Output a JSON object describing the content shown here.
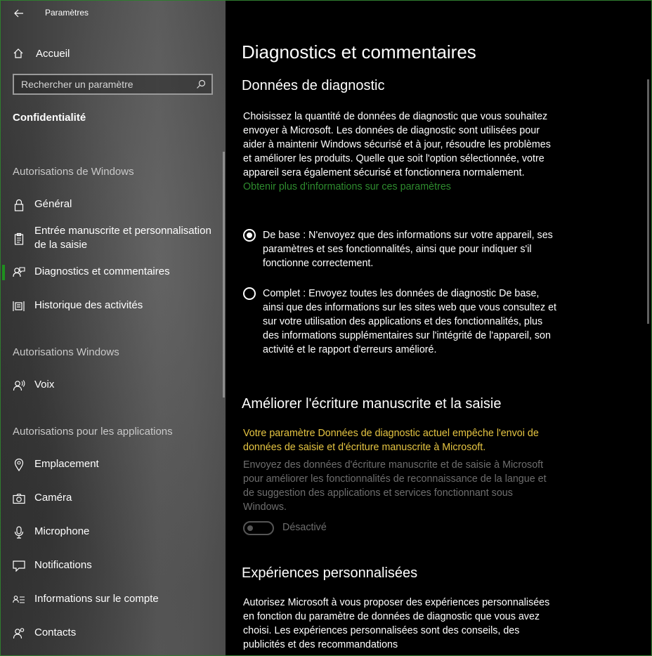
{
  "window": {
    "title": "Paramètres"
  },
  "sidebar": {
    "home_label": "Accueil",
    "search_placeholder": "Rechercher un paramètre",
    "section_title": "Confidentialité",
    "groups": [
      {
        "title": "Autorisations de Windows",
        "items": [
          {
            "label": "Général",
            "icon": "lock-icon"
          },
          {
            "label": "Entrée manuscrite et personnalisation de la saisie",
            "icon": "clipboard-icon"
          },
          {
            "label": "Diagnostics et commentaires",
            "icon": "feedback-icon",
            "active": true
          },
          {
            "label": "Historique des activités",
            "icon": "timeline-icon"
          }
        ]
      },
      {
        "title": "Autorisations Windows",
        "items": [
          {
            "label": "Voix",
            "icon": "voice-icon"
          }
        ]
      },
      {
        "title": "Autorisations pour les applications",
        "items": [
          {
            "label": "Emplacement",
            "icon": "location-icon"
          },
          {
            "label": "Caméra",
            "icon": "camera-icon"
          },
          {
            "label": "Microphone",
            "icon": "microphone-icon"
          },
          {
            "label": "Notifications",
            "icon": "notification-icon"
          },
          {
            "label": "Informations sur le compte",
            "icon": "account-info-icon"
          },
          {
            "label": "Contacts",
            "icon": "contacts-icon"
          }
        ]
      }
    ]
  },
  "main": {
    "page_title": "Diagnostics et commentaires",
    "diag": {
      "heading": "Données de diagnostic",
      "description": "Choisissez la quantité de données de diagnostic que vous souhaitez envoyer à Microsoft. Les données de diagnostic sont utilisées pour aider à maintenir Windows sécurisé et à jour, résoudre les problèmes et améliorer les produits. Quelle que soit l'option sélectionnée, votre appareil sera également sécurisé et fonctionnera normalement.",
      "link": "Obtenir plus d'informations sur ces paramètres",
      "options": [
        {
          "text": "De base : N'envoyez que des informations sur votre appareil, ses paramètres et ses fonctionnalités, ainsi que pour indiquer s'il fonctionne correctement.",
          "selected": true
        },
        {
          "text": "Complet : Envoyez toutes les données de diagnostic De base, ainsi que des informations sur les sites web que vous consultez et sur votre utilisation des applications et des fonctionnalités, plus des informations supplémentaires sur l'intégrité de l'appareil, son activité et le rapport d'erreurs amélioré.",
          "selected": false
        }
      ]
    },
    "inking": {
      "heading": "Améliorer l'écriture manuscrite et la saisie",
      "warning": "Votre paramètre Données de diagnostic actuel empêche l'envoi de données de saisie et d'écriture manuscrite à Microsoft.",
      "description": "Envoyez des données d'écriture manuscrite et de saisie à Microsoft pour améliorer les fonctionnalités de reconnaissance de la langue et de suggestion des applications et services fonctionnant sous Windows.",
      "toggle_label": "Désactivé",
      "toggle_on": false
    },
    "tailored": {
      "heading": "Expériences personnalisées",
      "description": "Autorisez Microsoft à vous proposer des expériences personnalisées en fonction du paramètre de données de diagnostic que vous avez choisi. Les expériences personnalisées sont des conseils, des publicités et des recommandations"
    }
  },
  "colors": {
    "accent": "#2e8b2e",
    "warning": "#e6c542",
    "disabled": "#6e6e6e"
  }
}
